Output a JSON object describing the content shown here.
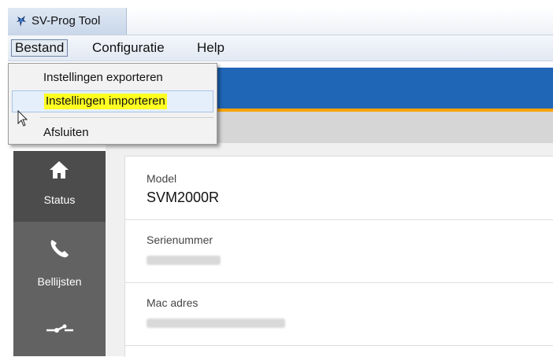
{
  "window": {
    "title": "SV-Prog Tool"
  },
  "menubar": {
    "items": [
      {
        "label": "Bestand"
      },
      {
        "label": "Configuratie"
      },
      {
        "label": "Help"
      }
    ]
  },
  "bestand_menu": {
    "items": [
      {
        "label": "Instellingen exporteren"
      },
      {
        "label": "Instellingen importeren",
        "highlighted": true
      },
      {
        "label": "Afsluiten"
      }
    ]
  },
  "sidebar": {
    "items": [
      {
        "label": "Status",
        "icon": "home-icon"
      },
      {
        "label": "Bellijsten",
        "icon": "phone-icon"
      },
      {
        "label": "",
        "icon": "connection-icon"
      }
    ]
  },
  "device": {
    "fields": [
      {
        "label": "Model",
        "value": "SVM2000R"
      },
      {
        "label": "Serienummer",
        "value": ""
      },
      {
        "label": "Mac adres",
        "value": ""
      }
    ]
  },
  "colors": {
    "banner": "#1f66b7",
    "accent": "#f7a300",
    "sidebar": "#626262",
    "highlight": "#ffff22"
  }
}
